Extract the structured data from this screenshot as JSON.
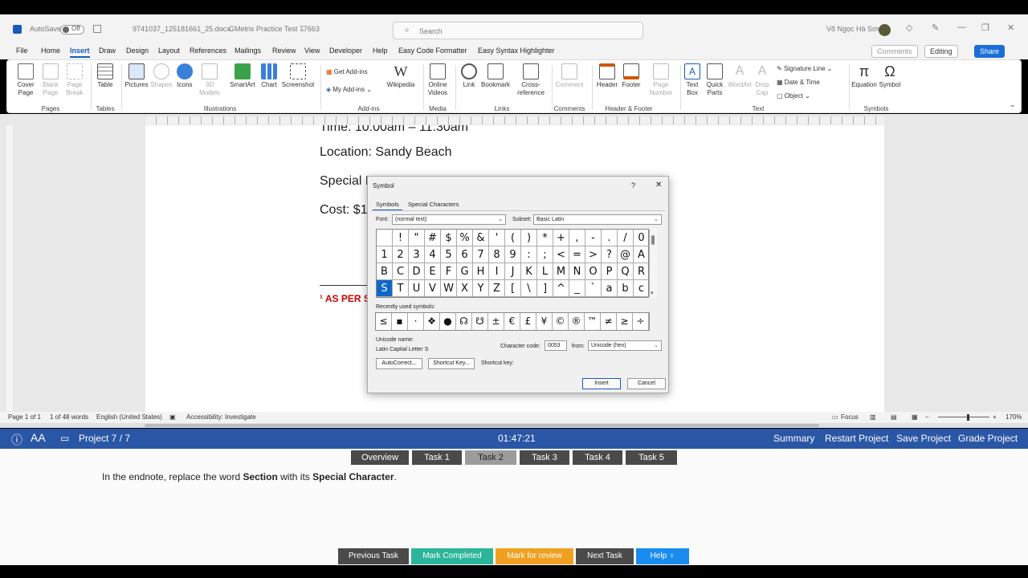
{
  "title_bar": {
    "autosave_label": "AutoSave",
    "autosave_state": "Off",
    "filename": "9741037_125181661_25.docx",
    "app_name": "GMetrix Practice Test 77663",
    "search_placeholder": "Search",
    "user_name": "Võ Ngọc Hà Sơn"
  },
  "menu": {
    "items": [
      "File",
      "Home",
      "Insert",
      "Draw",
      "Design",
      "Layout",
      "References",
      "Mailings",
      "Review",
      "View",
      "Developer",
      "Help",
      "Easy Code Formatter",
      "Easy Syntax Highlighter"
    ],
    "active": "Insert",
    "comments_label": "Comments",
    "editing_label": "Editing",
    "share_label": "Share"
  },
  "ribbon": {
    "pages": {
      "cover_page": "Cover Page",
      "blank_page": "Blank Page",
      "page_break": "Page Break",
      "group": "Pages"
    },
    "tables": {
      "table": "Table",
      "group": "Tables"
    },
    "illustrations": {
      "pictures": "Pictures",
      "shapes": "Shapes",
      "icons": "Icons",
      "models": "3D Models",
      "smartart": "SmartArt",
      "chart": "Chart",
      "screenshot": "Screenshot",
      "group": "Illustrations"
    },
    "addins": {
      "get": "Get Add-ins",
      "my": "My Add-ins",
      "wikipedia": "Wikipedia",
      "group": "Add-ins"
    },
    "media": {
      "online_videos": "Online Videos",
      "group": "Media"
    },
    "links": {
      "link": "Link",
      "bookmark": "Bookmark",
      "cross_reference": "Cross-reference",
      "group": "Links"
    },
    "comments": {
      "comment": "Comment",
      "group": "Comments"
    },
    "header_footer": {
      "header": "Header",
      "footer": "Footer",
      "page_number": "Page Number",
      "group": "Header & Footer"
    },
    "text": {
      "text_box": "Text Box",
      "quick_parts": "Quick Parts",
      "wordart": "WordArt",
      "drop_cap": "Drop Cap",
      "signature_line": "Signature Line",
      "date_time": "Date & Time",
      "object": "Object",
      "group": "Text"
    },
    "symbols": {
      "equation": "Equation",
      "symbol": "Symbol",
      "group": "Symbols"
    }
  },
  "document": {
    "line_time": "Time:  10:00am – 11:30am",
    "line_location": "Location:  Sandy Beach",
    "line_special": "Special R",
    "line_cost": "Cost:  $1",
    "red_text": "¹ AS PER S"
  },
  "status_bar": {
    "page": "Page 1 of 1",
    "words": "1 of 48 words",
    "language": "English (United States)",
    "accessibility": "Accessibility: Investigate",
    "focus": "Focus",
    "zoom": "170%"
  },
  "symbol_dialog": {
    "title": "Symbol",
    "help": "?",
    "close": "✕",
    "tabs": [
      "Symbols",
      "Special Characters"
    ],
    "font_label": "Font:",
    "font_value": "(normal text)",
    "subset_label": "Subset:",
    "subset_value": "Basic Latin",
    "grid_rows": [
      [
        " ",
        "!",
        "\"",
        "#",
        "$",
        "%",
        "&",
        "'",
        "(",
        ")",
        "*",
        "+",
        ",",
        "-",
        ".",
        "/",
        "0"
      ],
      [
        "1",
        "2",
        "3",
        "4",
        "5",
        "6",
        "7",
        "8",
        "9",
        ":",
        ";",
        "<",
        "=",
        ">",
        "?",
        "@",
        "A"
      ],
      [
        "B",
        "C",
        "D",
        "E",
        "F",
        "G",
        "H",
        "I",
        "J",
        "K",
        "L",
        "M",
        "N",
        "O",
        "P",
        "Q",
        "R"
      ],
      [
        "S",
        "T",
        "U",
        "V",
        "W",
        "X",
        "Y",
        "Z",
        "[",
        "\\",
        "]",
        "^",
        "_",
        "`",
        "a",
        "b",
        "c"
      ]
    ],
    "selected_symbol": "S",
    "recent_label": "Recently used symbols:",
    "recent_symbols": [
      "≤",
      "▪",
      "·",
      "❖",
      "●",
      "☊",
      "☋",
      "±",
      "€",
      "£",
      "¥",
      "©",
      "®",
      "™",
      "≠",
      "≥",
      "÷"
    ],
    "unicode_name_label": "Unicode name:",
    "unicode_name": "Latin Capital Letter S",
    "char_code_label": "Character code:",
    "char_code": "0053",
    "from_label": "from:",
    "from_value": "Unicode (hex)",
    "autocorrect_btn": "AutoCorrect...",
    "shortcut_key_btn": "Shortcut Key...",
    "shortcut_key_label": "Shortcut key:",
    "insert_btn": "Insert",
    "cancel_btn": "Cancel"
  },
  "gmetrix": {
    "project": "Project 7 / 7",
    "timer": "01:47:21",
    "actions": [
      "Summary",
      "Restart Project",
      "Save Project",
      "Grade Project"
    ],
    "tasks": [
      "Overview",
      "Task 1",
      "Task 2",
      "Task 3",
      "Task 4",
      "Task 5"
    ],
    "active_task": "Task 2",
    "instruction_pre": "In the endnote, replace the word ",
    "instruction_b1": "Section",
    "instruction_mid": " with its ",
    "instruction_b2": "Special Character",
    "instruction_end": ".",
    "bottom_buttons": [
      "Previous Task",
      "Mark Completed",
      "Mark for review",
      "Next Task",
      "Help"
    ],
    "colors": {
      "bar": "#2a56a6",
      "prev": "#4a4a4a",
      "completed": "#2bb59a",
      "review": "#f0a020",
      "next": "#4a4a4a",
      "help": "#1a8cf0"
    }
  }
}
